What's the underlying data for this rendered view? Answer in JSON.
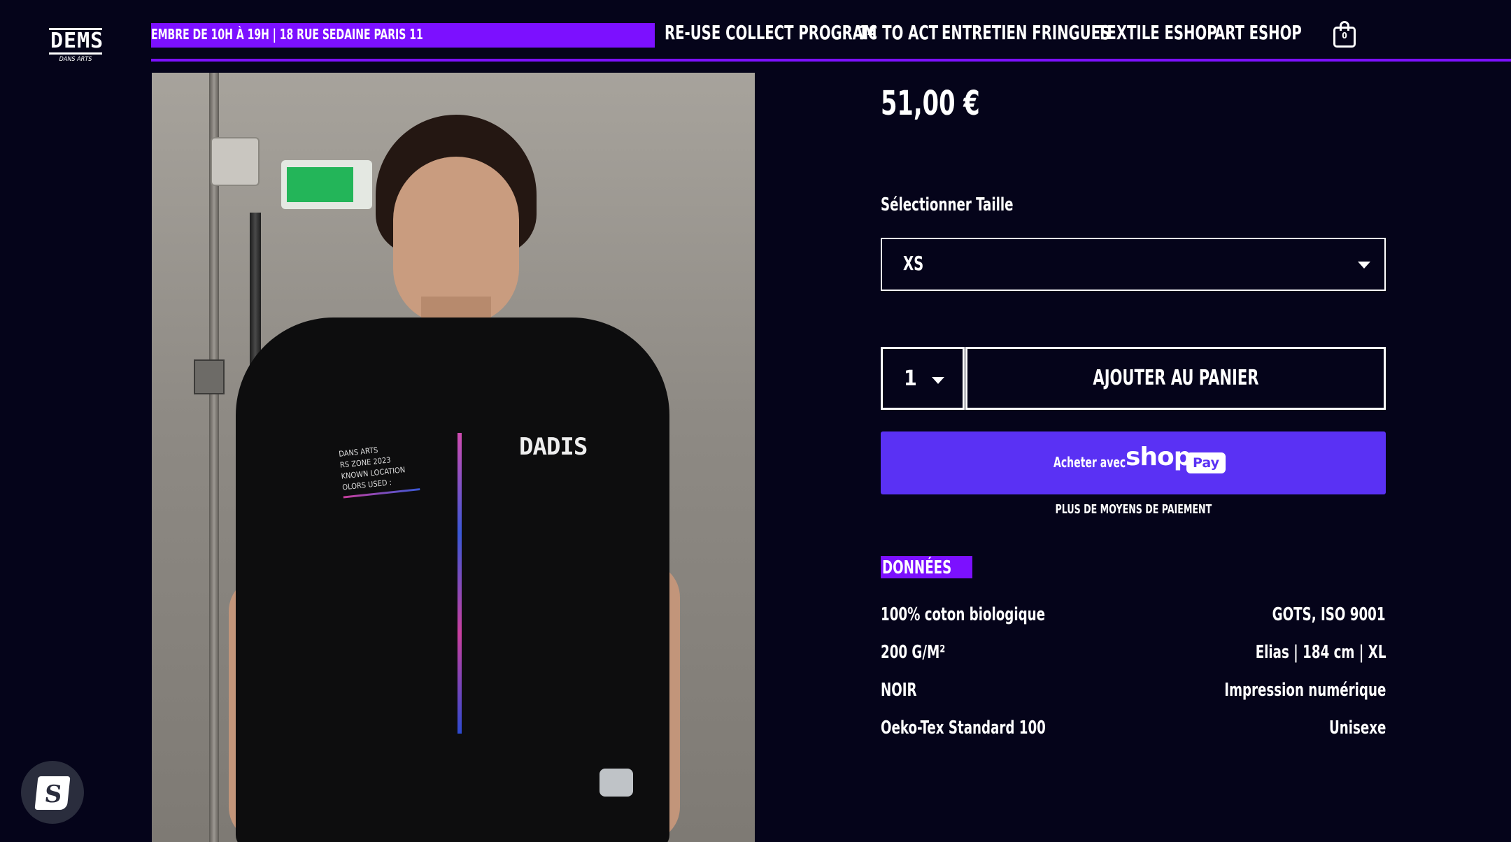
{
  "header": {
    "logo_text": "DEMS",
    "logo_sub": "DANS ARTS",
    "announcement": "EMBRE DE 10H À 19H | 18 RUE SEDAINE PARIS 11",
    "nav": [
      "RE-USE COLLECT PROGRAM",
      "1€ TO ACT",
      "ENTRETIEN FRINGUES",
      "TEXTILE ESHOP",
      "ART ESHOP"
    ],
    "cart_count": "0",
    "accent_color": "#7c10ff"
  },
  "product": {
    "image_alt_icon": "product-photo",
    "shirt_logo": "DADIS",
    "shirt_print": [
      "DANS ARTS",
      "RS ZONE 2023",
      "KNOWN LOCATION",
      "OLORS USED :"
    ],
    "price": "51,00 €",
    "size_label": "Sélectionner Taille",
    "size_value": "XS",
    "quantity": "1",
    "add_to_cart": "AJOUTER AU PANIER",
    "shoppay_prefix": "Acheter avec",
    "shoppay_brand": "shop",
    "shoppay_pay": "Pay",
    "more_payment": "PLUS DE MOYENS DE PAIEMENT"
  },
  "details": {
    "title": "DONNÉES",
    "rows": [
      {
        "left": "100% coton biologique",
        "right": "GOTS, ISO 9001"
      },
      {
        "left": "200 G/M²",
        "right": "Elias | 184 cm | XL"
      },
      {
        "left": "NOIR",
        "right": "Impression numérique"
      },
      {
        "left": "Oeko-Tex Standard 100",
        "right": "Unisexe"
      }
    ]
  },
  "colors": {
    "background": "#05041a",
    "purple": "#7c10ff",
    "shoppay": "#5a31f4"
  }
}
